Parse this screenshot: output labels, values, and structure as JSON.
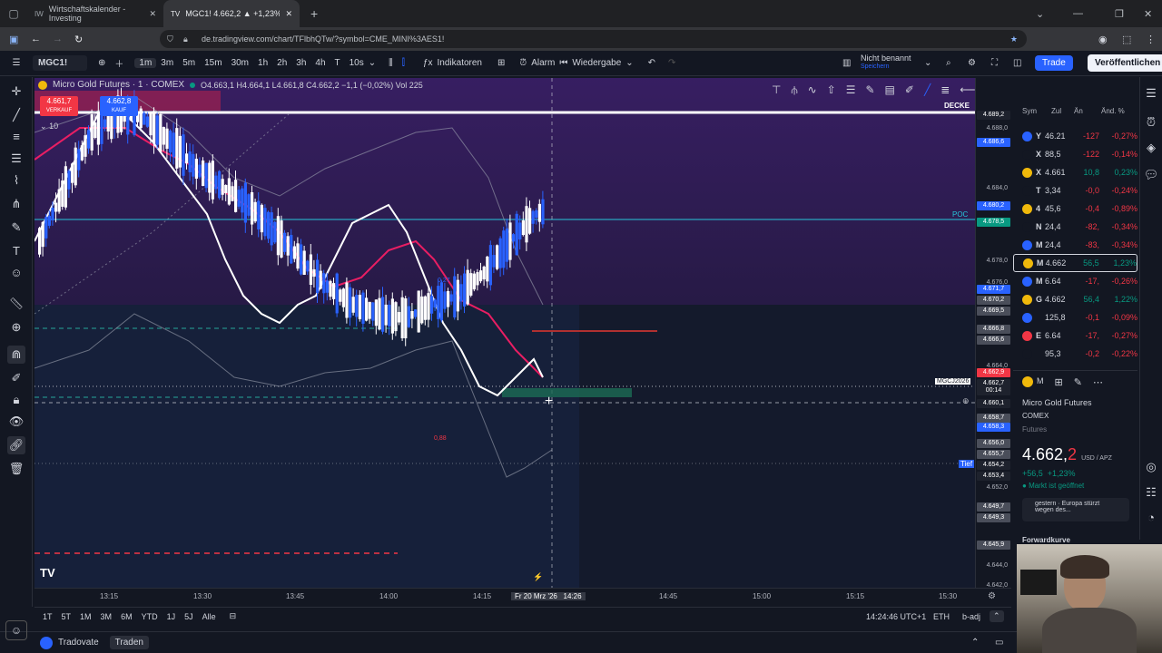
{
  "browser": {
    "tabs": [
      {
        "label": "Wirtschaftskalender - Investing"
      },
      {
        "label": "MGC1! 4.662,2 ▲ +1,23% Nich"
      }
    ],
    "url": "de.tradingview.com/chart/TFlbhQTw/?symbol=CME_MINI%3AES1!"
  },
  "toolbar": {
    "symbol": "MGC1!",
    "intervals": [
      "1m",
      "3m",
      "5m",
      "15m",
      "30m",
      "1h",
      "2h",
      "3h",
      "4h",
      "T",
      "10s"
    ],
    "selected_interval": "1m",
    "indicators": "Indikatoren",
    "alarm": "Alarm",
    "replay": "Wiedergabe",
    "layout_name": "Nicht benannt",
    "layout_sub": "Speichern",
    "trade": "Trade",
    "publish": "Veröffentlichen"
  },
  "legend": {
    "title": "Micro Gold Futures · 1 · COMEX",
    "ohlc": "O4.663,1 H4.664,1 L4.661,8 C4.662,2 −1,1 (−0,02%) Vol 225",
    "sell_price": "4.661,7",
    "sell_label": "VERKAUF",
    "buy_price": "4.662,8",
    "buy_label": "KAUF",
    "qty": "10"
  },
  "chart_labels": {
    "decke": "DECKE",
    "poc": "POC",
    "tief": "Tief",
    "contract": "MGCJ2026",
    "ann_1": "0,27",
    "ann_2": "0,88"
  },
  "price_axis": {
    "labels": [
      "4.688,0",
      "4.684,0",
      "4.682,0",
      "4.678,0",
      "4.676,0",
      "4.674,0",
      "4.664,0",
      "4.656,0",
      "4.652,0",
      "4.647,0",
      "4.644,0",
      "4.642,0"
    ],
    "badges": [
      {
        "text": "4.689,2",
        "color": "#1e222d"
      },
      {
        "text": "4.686,6",
        "color": "#2962ff"
      },
      {
        "text": "4.680,2",
        "color": "#2962ff"
      },
      {
        "text": "4.678,5",
        "color": "#089981"
      },
      {
        "text": "4.671,7",
        "color": "#2962ff"
      },
      {
        "text": "4.670,2",
        "color": "#4a4e5a"
      },
      {
        "text": "4.669,5",
        "color": "#4a4e5a"
      },
      {
        "text": "4.666,8",
        "color": "#4a4e5a"
      },
      {
        "text": "4.666,6",
        "color": "#4a4e5a"
      },
      {
        "text": "4.662,9",
        "color": "#f23645"
      },
      {
        "text": "4.662,7",
        "color": "#1e222d"
      },
      {
        "text": "00:14",
        "color": "#1e222d"
      },
      {
        "text": "4.660,1",
        "color": "#1e222d"
      },
      {
        "text": "4.658,7",
        "color": "#4a4e5a"
      },
      {
        "text": "4.658,3",
        "color": "#2962ff"
      },
      {
        "text": "4.656,0",
        "color": "#4a4e5a"
      },
      {
        "text": "4.655,7",
        "color": "#4a4e5a"
      },
      {
        "text": "4.654,2",
        "color": "#1e222d"
      },
      {
        "text": "4.653,4",
        "color": "#1e222d"
      },
      {
        "text": "4.649,7",
        "color": "#4a4e5a"
      },
      {
        "text": "4.649,3",
        "color": "#4a4e5a"
      },
      {
        "text": "4.645,9",
        "color": "#4a4e5a"
      }
    ]
  },
  "time_axis": {
    "labels": [
      "13:15",
      "13:30",
      "13:45",
      "14:00",
      "14:15",
      "14:45",
      "15:00",
      "15:15",
      "15:30"
    ],
    "cursor": "Fr 20 Mrz '26   14:26"
  },
  "bottom": {
    "ranges": [
      "1T",
      "5T",
      "1M",
      "3M",
      "6M",
      "YTD",
      "1J",
      "5J",
      "Alle"
    ],
    "clock": "14:24:46 UTC+1",
    "session": "ETH",
    "adj": "b-adj"
  },
  "status": {
    "broker": "Tradovate",
    "trade_tab": "Traden"
  },
  "watchlist": {
    "headers": [
      "Sym",
      "Zul",
      "Än",
      "Änd. %"
    ],
    "rows": [
      {
        "sym": "Y",
        "last": "46.21",
        "chg": "-127",
        "pct": "-0,27%",
        "dir": "neg",
        "icon": "#2962ff"
      },
      {
        "sym": "X",
        "last": "88,5",
        "chg": "-122",
        "pct": "-0,14%",
        "dir": "neg",
        "icon": "#131722"
      },
      {
        "sym": "X",
        "last": "4.661",
        "chg": "10,8",
        "pct": "0,23%",
        "dir": "pos",
        "icon": "#f0b90b"
      },
      {
        "sym": "T",
        "last": "3,34",
        "chg": "-0,0",
        "pct": "-0,24%",
        "dir": "neg",
        "icon": "#131722"
      },
      {
        "sym": "4",
        "last": "45,6",
        "chg": "-0,4",
        "pct": "-0,89%",
        "dir": "neg",
        "icon": "#f0b90b"
      },
      {
        "sym": "N",
        "last": "24,4",
        "chg": "-82,",
        "pct": "-0,34%",
        "dir": "neg",
        "icon": "#131722"
      },
      {
        "sym": "M",
        "last": "24,4",
        "chg": "-83,",
        "pct": "-0,34%",
        "dir": "neg",
        "icon": "#2962ff"
      },
      {
        "sym": "M",
        "last": "4.662",
        "chg": "56,5",
        "pct": "1,23%",
        "dir": "pos",
        "icon": "#f0b90b"
      },
      {
        "sym": "M",
        "last": "6.64",
        "chg": "-17,",
        "pct": "-0,26%",
        "dir": "neg",
        "icon": "#2962ff"
      },
      {
        "sym": "G",
        "last": "4.662",
        "chg": "56,4",
        "pct": "1,22%",
        "dir": "pos",
        "icon": "#f0b90b"
      },
      {
        "sym": "",
        "last": "125,8",
        "chg": "-0,1",
        "pct": "-0,09%",
        "dir": "neg",
        "icon": "#2962ff"
      },
      {
        "sym": "E",
        "last": "6.64",
        "chg": "-17,",
        "pct": "-0,27%",
        "dir": "neg",
        "icon": "#f23645"
      },
      {
        "sym": "",
        "last": "95,3",
        "chg": "-0,2",
        "pct": "-0,22%",
        "dir": "neg",
        "icon": "#131722"
      }
    ]
  },
  "detail": {
    "name": "Micro Gold Futures",
    "exchange": "COMEX",
    "type": "Futures",
    "price_main": "4.662,",
    "price_dec": "2",
    "currency": "USD / APZ",
    "change": "+56,5  +1,23%",
    "market": "Markt ist geöffnet",
    "news": "gestern · Europa stürzt wegen des...",
    "forward": "Forwardkurve",
    "mini_sym": "M"
  },
  "colors": {
    "accent": "#2962ff",
    "up": "#089981",
    "down": "#f23645",
    "bg": "#131722"
  }
}
